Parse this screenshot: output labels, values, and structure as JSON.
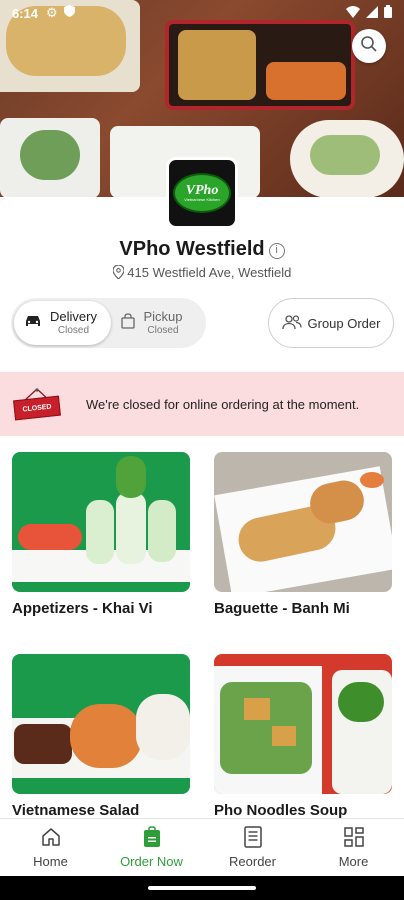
{
  "status_bar": {
    "time": "6:14"
  },
  "hero": {
    "search_icon": "search-icon"
  },
  "restaurant": {
    "logo_text": "VPho",
    "logo_subtext": "Vietnamese Kitchen",
    "name": "VPho Westfield",
    "info_icon": "info-icon",
    "address": "415 Westfield Ave, Westfield"
  },
  "order_mode": {
    "delivery": {
      "label": "Delivery",
      "status": "Closed"
    },
    "pickup": {
      "label": "Pickup",
      "status": "Closed"
    }
  },
  "group_order": {
    "label": "Group Order"
  },
  "closed_banner": {
    "sign_text": "CLOSED",
    "message": "We're closed for online ordering at the moment."
  },
  "categories": [
    {
      "label": "Appetizers - Khai Vi"
    },
    {
      "label": "Baguette - Banh Mi"
    },
    {
      "label": "Vietnamese Salad"
    },
    {
      "label": "Pho Noodles Soup"
    }
  ],
  "bottom_nav": [
    {
      "label": "Home",
      "icon": "home-icon"
    },
    {
      "label": "Order Now",
      "icon": "order-bag-icon",
      "active": true
    },
    {
      "label": "Reorder",
      "icon": "receipt-icon"
    },
    {
      "label": "More",
      "icon": "grid-icon"
    }
  ],
  "colors": {
    "accent": "#2e9e3a",
    "banner_bg": "#fbdcdf",
    "closed_red": "#c8202a"
  }
}
